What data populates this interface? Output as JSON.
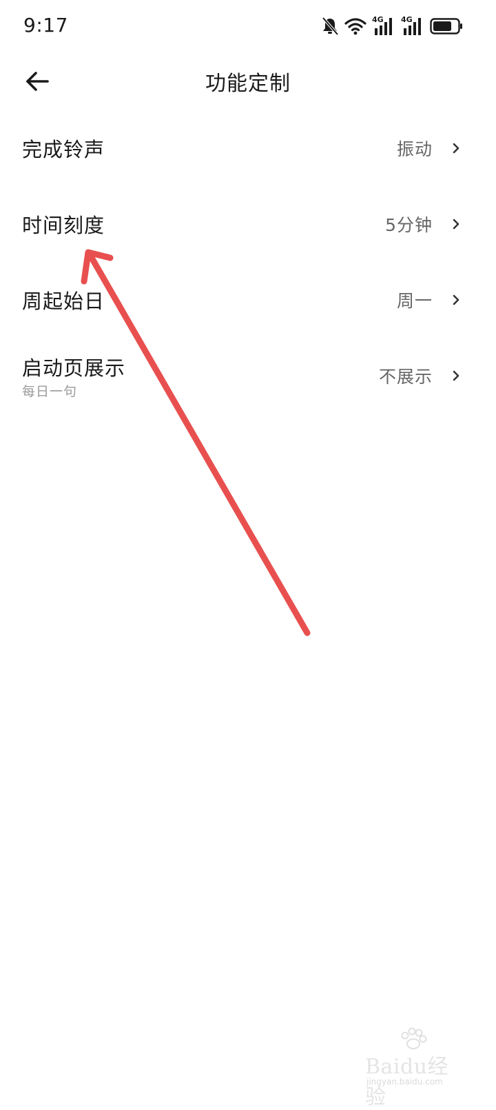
{
  "status_bar": {
    "time": "9:17",
    "net1": "4G",
    "net2": "4G",
    "icons": [
      "bell-off-icon",
      "wifi-icon",
      "signal-icon",
      "signal-icon",
      "battery-icon"
    ]
  },
  "header": {
    "title": "功能定制",
    "back_icon": "arrow-left-icon"
  },
  "settings": {
    "items": [
      {
        "label": "完成铃声",
        "value": "振动"
      },
      {
        "label": "时间刻度",
        "value": "5分钟"
      },
      {
        "label": "周起始日",
        "value": "周一"
      },
      {
        "label": "启动页展示",
        "sublabel": "每日一句",
        "value": "不展示"
      }
    ]
  },
  "annotation": {
    "color": "#e8504f"
  },
  "watermark": {
    "logo": "Baidu经验",
    "url": "jingyan.baidu.com"
  },
  "colors": {
    "text": "#1a1a1a",
    "value": "#666666",
    "sublabel": "#9a9a9a",
    "background": "#ffffff"
  }
}
